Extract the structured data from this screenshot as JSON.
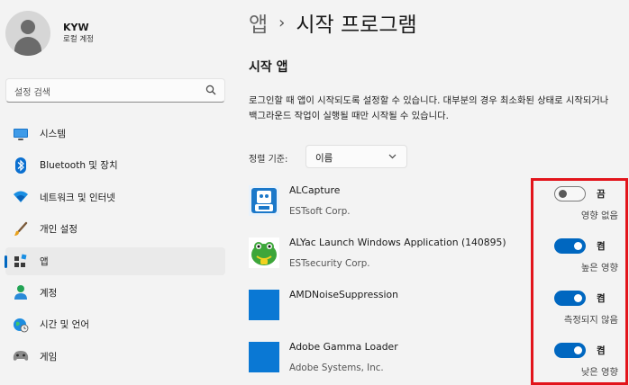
{
  "profile": {
    "name": "KYW",
    "account_type": "로컬 계정"
  },
  "search": {
    "placeholder": "설정 검색"
  },
  "nav": {
    "items": [
      {
        "label": "시스템",
        "icon": "system-monitor-icon"
      },
      {
        "label": "Bluetooth 및 장치",
        "icon": "bluetooth-icon"
      },
      {
        "label": "네트워크 및 인터넷",
        "icon": "wifi-icon"
      },
      {
        "label": "개인 설정",
        "icon": "brush-icon"
      },
      {
        "label": "앱",
        "icon": "apps-icon",
        "active": true
      },
      {
        "label": "계정",
        "icon": "person-icon"
      },
      {
        "label": "시간 및 언어",
        "icon": "globe-clock-icon"
      },
      {
        "label": "게임",
        "icon": "gamepad-icon"
      }
    ]
  },
  "breadcrumb": {
    "parent": "앱",
    "separator": "›",
    "current": "시작 프로그램"
  },
  "section": {
    "title": "시작 앱",
    "description": "로그인할 때 앱이 시작되도록 설정할 수 있습니다. 대부분의 경우 최소화된 상태로 시작되거나 백그라운드 작업이 실행될 때만 시작될 수 있습니다."
  },
  "sort": {
    "label": "정렬 기준:",
    "value": "이름"
  },
  "apps": [
    {
      "name": "ALCapture",
      "publisher": "ESTsoft Corp.",
      "toggle_label": "끔",
      "state": "off",
      "impact": "영향 없음",
      "icon": "alcapture-icon"
    },
    {
      "name": "ALYac Launch Windows Application (140895)",
      "publisher": "ESTsecurity Corp.",
      "toggle_label": "켬",
      "state": "on",
      "impact": "높은 영향",
      "icon": "alyac-icon"
    },
    {
      "name": "AMDNoiseSuppression",
      "publisher": "",
      "toggle_label": "켬",
      "state": "on",
      "impact": "측정되지 않음",
      "icon": "generic-app-icon"
    },
    {
      "name": "Adobe Gamma Loader",
      "publisher": "Adobe Systems, Inc.",
      "toggle_label": "켬",
      "state": "on",
      "impact": "낮은 영향",
      "icon": "generic-app-icon"
    }
  ],
  "colors": {
    "accent": "#0067c0",
    "app_icon_blue": "#0a78d4",
    "highlight_red": "#e2141b"
  }
}
